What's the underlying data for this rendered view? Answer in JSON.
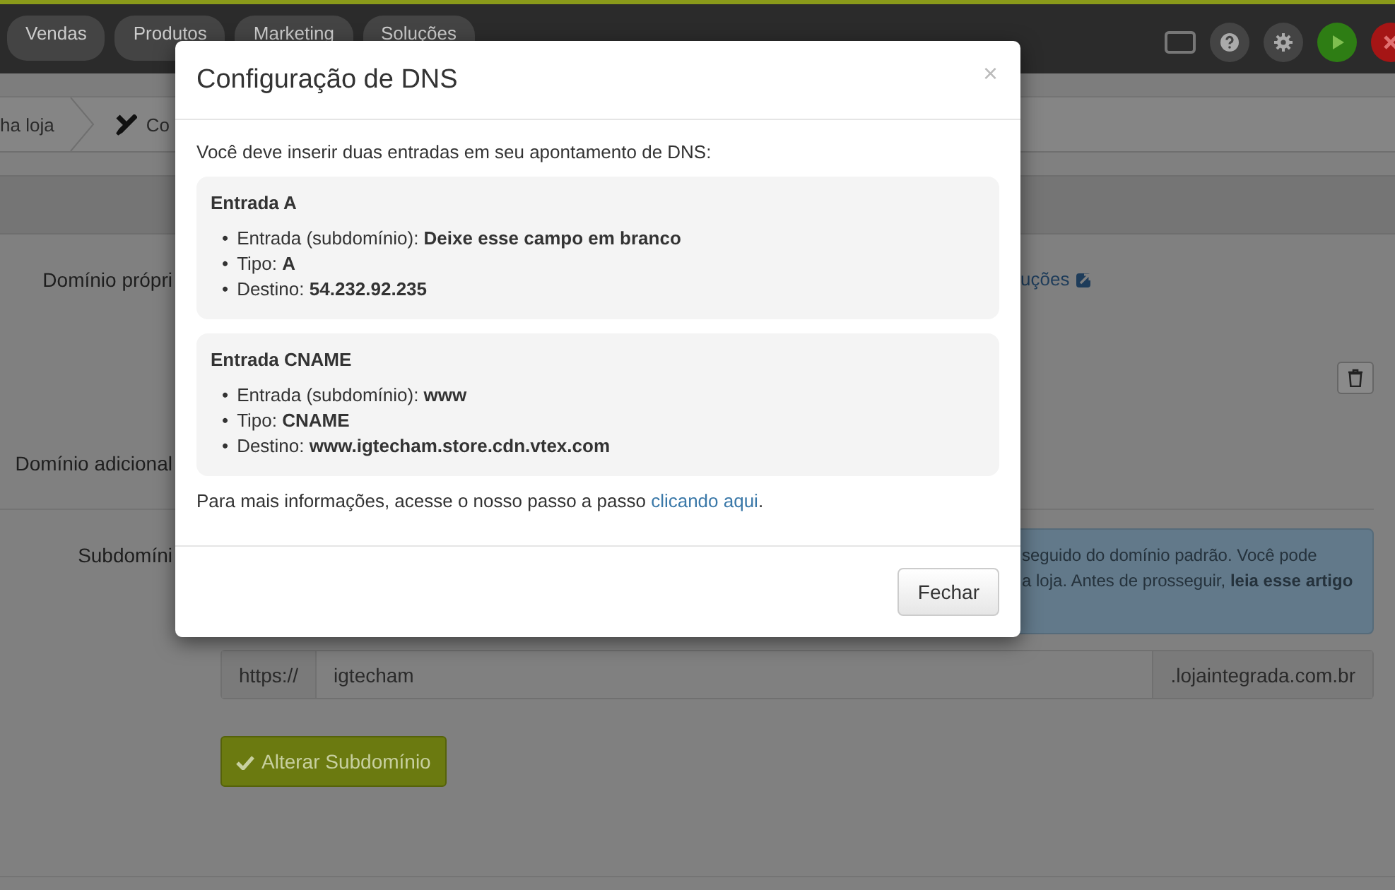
{
  "top_nav": [
    {
      "label": "Vendas"
    },
    {
      "label": "Produtos"
    },
    {
      "label": "Marketing"
    },
    {
      "label": "Soluções"
    }
  ],
  "breadcrumb": [
    {
      "label": "ha loja"
    },
    {
      "label": "Co"
    }
  ],
  "form": {
    "own_domain": {
      "label": "Domínio própri",
      "link": "uções"
    },
    "extra_domain": {
      "label": "Domínio adicional"
    },
    "subdomain": {
      "label": "Subdomíni",
      "info_lines": [
        "seguido do domínio padrão. Você pode",
        "a loja. Antes de prosseguir, **leia esse artigo**"
      ],
      "prefix": "https://",
      "value": "igtecham",
      "suffix": ".lojaintegrada.com.br",
      "button": "Alterar Subdomínio"
    }
  },
  "modal": {
    "title": "Configuração de DNS",
    "close": "×",
    "bullet": "•",
    "intro": "Você deve inserir duas entradas em seu apontamento de DNS:",
    "entries": [
      {
        "title": "Entrada A",
        "items": [
          "Entrada (subdomínio): **Deixe esse campo em branco**",
          "Tipo: **A**",
          "Destino: **54.232.92.235**"
        ]
      },
      {
        "title": "Entrada CNAME",
        "items": [
          "Entrada (subdomínio): **www**",
          "Tipo: **CNAME**",
          "Destino: **www.igtecham.store.cdn.vtex.com**"
        ]
      }
    ],
    "footer_text": "Para mais informações, acesse o nosso passo a passo ",
    "footer_link": "clicando aqui",
    "footer_end": ".",
    "button": "Fechar"
  }
}
